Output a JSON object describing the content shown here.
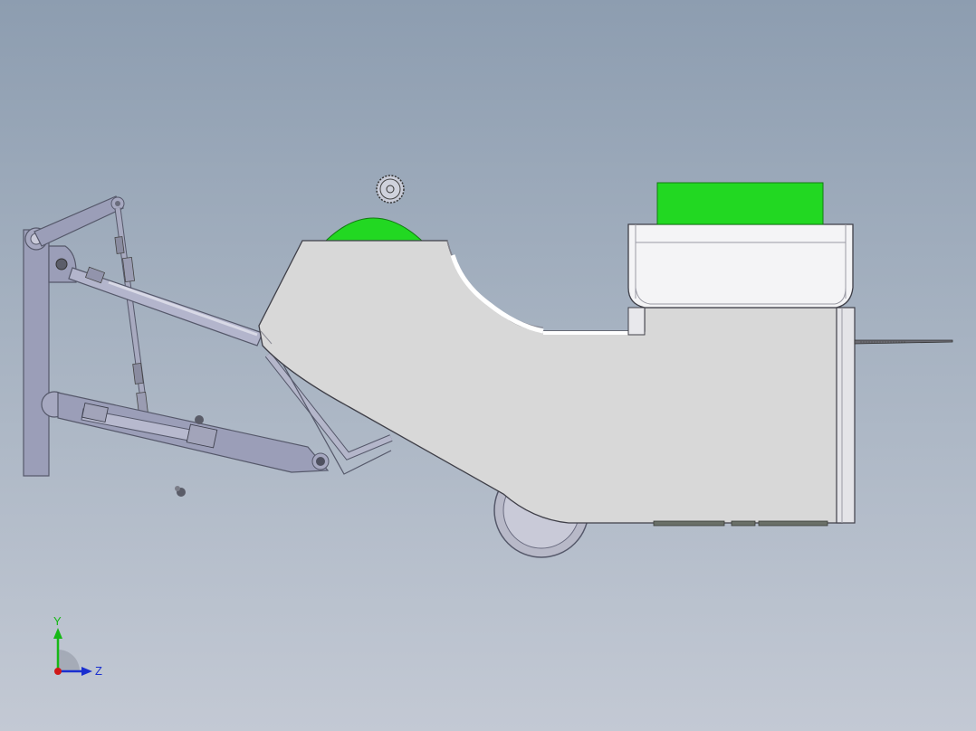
{
  "viewport": {
    "background_top": "#8d9db0",
    "background_bottom": "#c3c9d4"
  },
  "model": {
    "body_color": "#d8d8d8",
    "frame_color": "#9b9eb8",
    "accent_green": "#22d822",
    "wheel_color": "#b8b9c8"
  },
  "triad": {
    "y_label": "Y",
    "z_label": "Z",
    "y_color": "#16b816",
    "z_color": "#1a2fd0",
    "x_color": "#d01818"
  }
}
